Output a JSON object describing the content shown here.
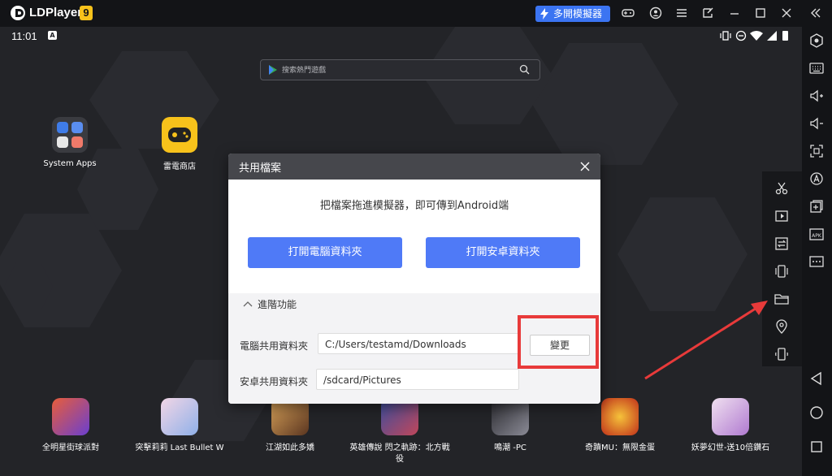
{
  "titlebar": {
    "app_name": "LDPlayer",
    "version": "9",
    "multi_button": "多開模擬器",
    "icons": [
      "gamepad-icon",
      "account-icon",
      "menu-icon",
      "restore-icon",
      "minimize-icon",
      "maximize-icon",
      "close-icon",
      "collapse-icon"
    ]
  },
  "status_bar": {
    "time": "11:01",
    "notification_icon": "A"
  },
  "search": {
    "placeholder": "搜索熱門遊戲"
  },
  "desktop_apps": [
    {
      "label": "System Apps"
    },
    {
      "label": "雷電商店"
    }
  ],
  "dock_apps": [
    {
      "label": "全明星街球派對"
    },
    {
      "label": "突擊莉莉 Last Bullet W"
    },
    {
      "label": "江湖如此多嬌"
    },
    {
      "label": "英雄傳說 閃之軌跡：北方戰"
    },
    {
      "label_line2": "役"
    },
    {
      "label": "鳴潮 -PC"
    },
    {
      "label": "奇蹟MU：無限金蛋"
    },
    {
      "label": "妖夢幻世-送10倍鑽石"
    }
  ],
  "dialog": {
    "title": "共用檔案",
    "message": "把檔案拖進模擬器，即可傳到Android端",
    "open_pc_folder": "打開電腦資料夾",
    "open_android_folder": "打開安卓資料夾",
    "advanced_label": "進階功能",
    "pc_shared_label": "電腦共用資料夾",
    "pc_shared_path": "C:/Users/testamd/Downloads",
    "change_label": "變更",
    "android_shared_label": "安卓共用資料夾",
    "android_shared_path": "/sdcard/Pictures"
  },
  "colors": {
    "accent_blue": "#4f7af7",
    "highlight_red": "#e83a3a",
    "version_badge": "#f7c21b"
  }
}
